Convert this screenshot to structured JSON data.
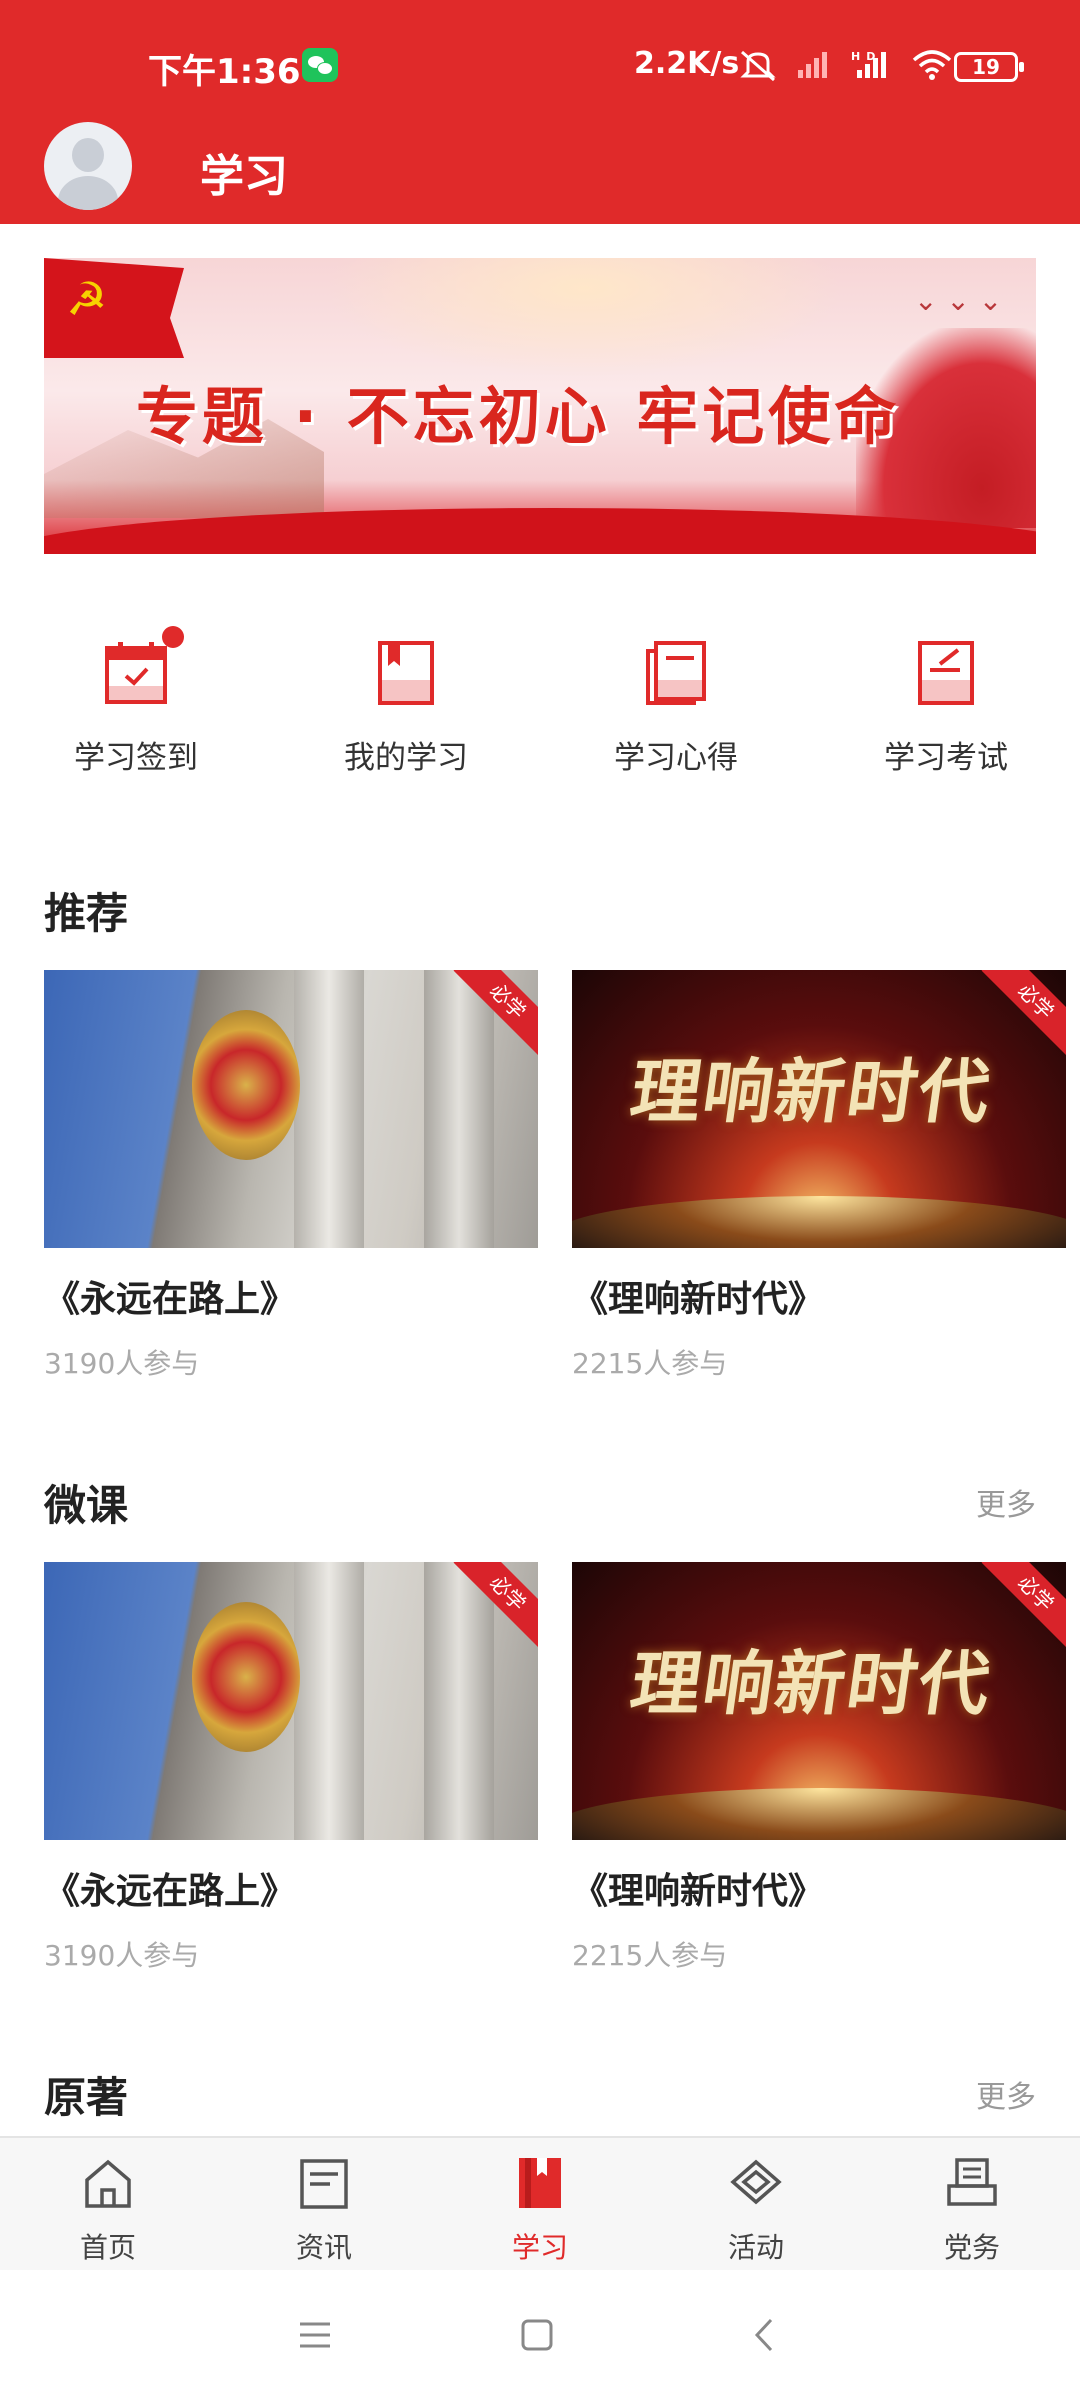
{
  "status_bar": {
    "time": "下午1:36",
    "net_speed": "2.2K/s",
    "signal_text": "HD",
    "battery": "19"
  },
  "header": {
    "title": "学习"
  },
  "banner": {
    "title": "专题 · 不忘初心  牢记使命"
  },
  "quick_entries": [
    {
      "label": "学习签到",
      "icon": "calendar-check-icon",
      "badge": true
    },
    {
      "label": "我的学习",
      "icon": "book-bookmark-icon",
      "badge": false
    },
    {
      "label": "学习心得",
      "icon": "notebook-icon",
      "badge": false
    },
    {
      "label": "学习考试",
      "icon": "exam-edit-icon",
      "badge": false
    }
  ],
  "sections": {
    "recommend": {
      "title": "推荐",
      "items": [
        {
          "title": "《永远在路上》",
          "participants": "3190人参与",
          "tag": "必学"
        },
        {
          "title": "《理响新时代》",
          "participants": "2215人参与",
          "tag": "必学",
          "thumb_text": "理响新时代"
        }
      ]
    },
    "micro": {
      "title": "微课",
      "more": "更多",
      "items": [
        {
          "title": "《永远在路上》",
          "participants": "3190人参与",
          "tag": "必学"
        },
        {
          "title": "《理响新时代》",
          "participants": "2215人参与",
          "tag": "必学",
          "thumb_text": "理响新时代"
        }
      ]
    },
    "original": {
      "title": "原著",
      "more": "更多"
    }
  },
  "bottom_nav": [
    {
      "label": "首页",
      "icon": "home-icon"
    },
    {
      "label": "资讯",
      "icon": "news-icon"
    },
    {
      "label": "学习",
      "icon": "study-book-icon",
      "active": true
    },
    {
      "label": "活动",
      "icon": "activity-icon"
    },
    {
      "label": "党务",
      "icon": "party-affairs-icon"
    }
  ],
  "colors": {
    "brand_red": "#e02a2a",
    "text_dark": "#222222",
    "text_muted": "#aaaaaa"
  }
}
